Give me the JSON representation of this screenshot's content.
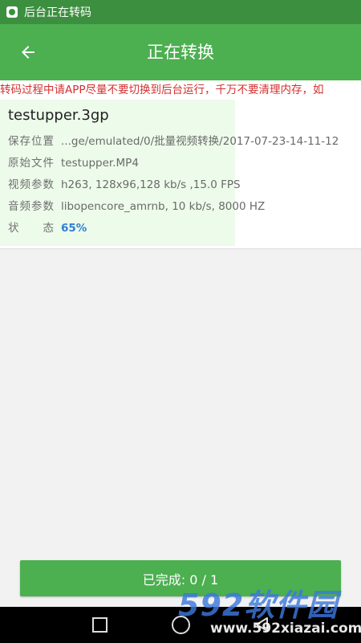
{
  "status_bar": {
    "notification_text": "后台正在转码",
    "icon": "app-notification-icon"
  },
  "header": {
    "title": "正在转换",
    "back_icon": "arrow-back-icon"
  },
  "warning": {
    "text": "转码过程中请APP尽量不要切换到后台运行，千万不要清理内存，如"
  },
  "task": {
    "file_name": "testupper.3gp",
    "rows": [
      {
        "label": "保存位置",
        "value": "...ge/emulated/0/批量视频转换/2017-07-23-14-11-12"
      },
      {
        "label": "原始文件",
        "value": "testupper.MP4"
      },
      {
        "label": "视频参数",
        "value": "h263, 128x96,128 kb/s ,15.0 FPS"
      },
      {
        "label": "音频参数",
        "value": "libopencore_amrnb, 10 kb/s, 8000 HZ"
      }
    ],
    "status_label": "状　　态",
    "status_value": "65%",
    "progress": 0.65
  },
  "footer": {
    "done_label": "已完成: 0 / 1"
  },
  "watermark": {
    "brand": "592软件园",
    "url": "www.592xiazai.com"
  },
  "colors": {
    "primary": "#4caf50",
    "primary_dark": "#3d8f40",
    "warning": "#d32f2f",
    "progress_fill": "#edfbea",
    "status_accent": "#2e7fd6"
  }
}
